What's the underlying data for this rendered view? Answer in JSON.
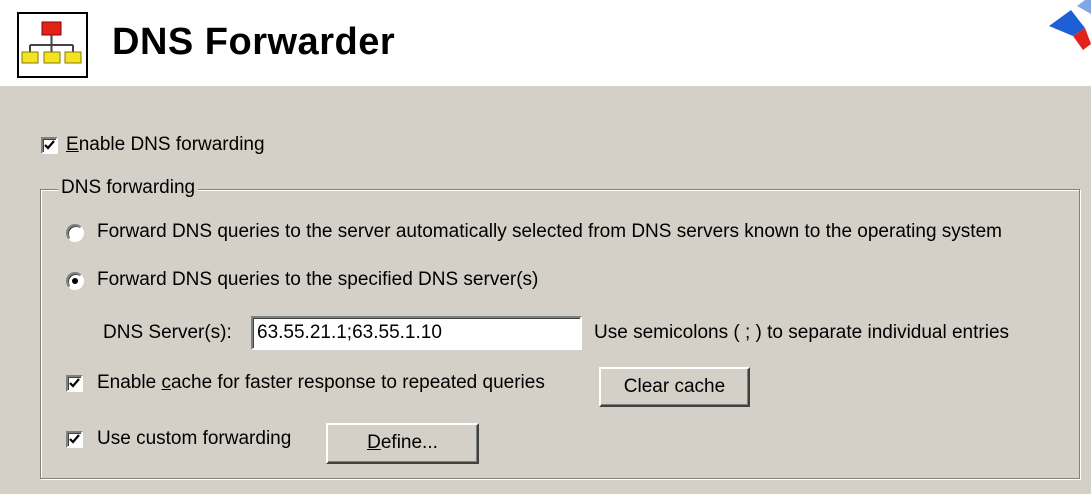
{
  "header": {
    "title": "DNS Forwarder",
    "icon": "network-icon"
  },
  "enable_forwarding": {
    "label_accel": "E",
    "label_rest": "nable DNS forwarding",
    "checked": true
  },
  "group": {
    "legend": "DNS forwarding",
    "option_auto": {
      "label": "Forward DNS queries to the server automatically selected from DNS servers known to the operating system",
      "selected": false
    },
    "option_specified": {
      "label": "Forward DNS queries to the specified DNS server(s)",
      "selected": true
    },
    "dns_server": {
      "label": "DNS Server(s):",
      "value": "63.55.21.1;63.55.1.10",
      "hint": "Use semicolons ( ; ) to separate individual entries"
    },
    "enable_cache": {
      "label_pre": "Enable ",
      "label_accel": "c",
      "label_post": "ache for faster response to repeated queries",
      "checked": true
    },
    "clear_cache_button": "Clear cache",
    "custom_forwarding": {
      "label": "Use custom forwarding",
      "checked": true
    },
    "define_button": {
      "accel": "D",
      "rest": "efine..."
    }
  },
  "colors": {
    "panel_bg": "#d4d0c8",
    "accent_blue": "#1f5fd6",
    "accent_red": "#e2231a"
  }
}
